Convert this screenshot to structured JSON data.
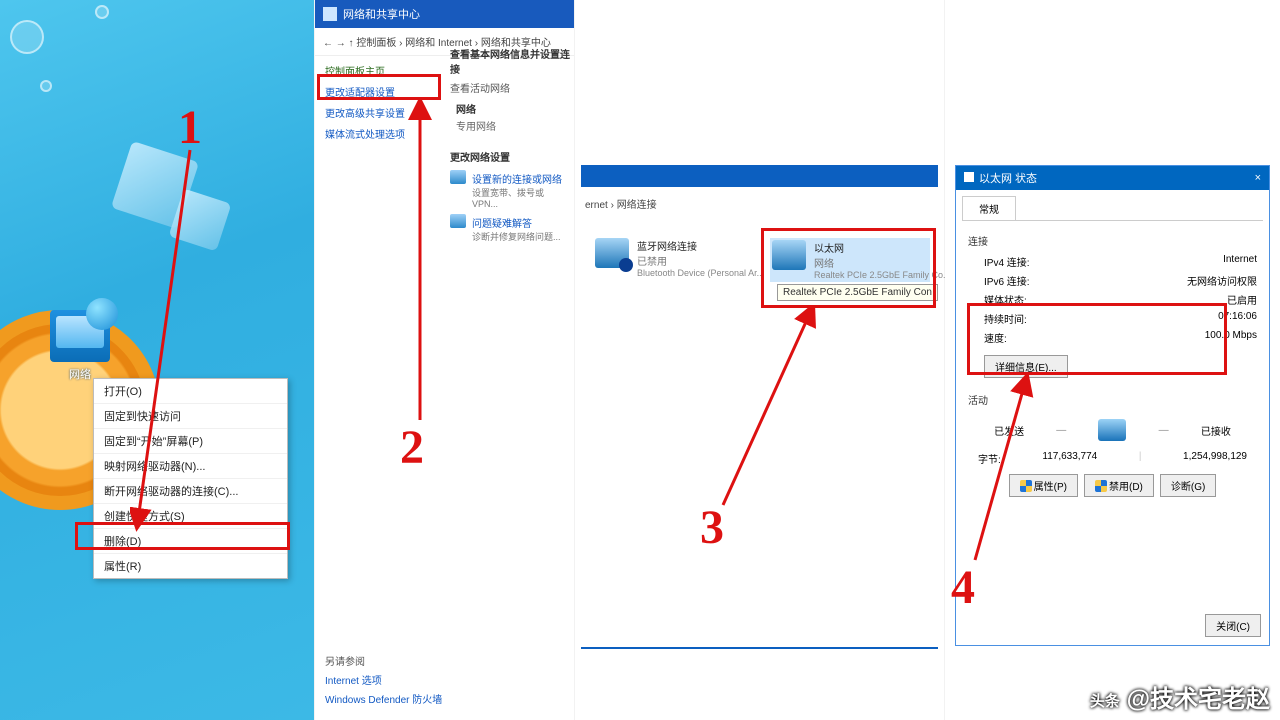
{
  "steps": {
    "one": "1",
    "two": "2",
    "three": "3",
    "four": "4"
  },
  "panel1": {
    "icon_label": "网络",
    "context_menu": [
      "打开(O)",
      "固定到快速访问",
      "固定到“开始”屏幕(P)",
      "映射网络驱动器(N)...",
      "断开网络驱动器的连接(C)...",
      "创建快捷方式(S)",
      "删除(D)",
      "属性(R)"
    ]
  },
  "panel2": {
    "title": "网络和共享中心",
    "breadcrumb_items": [
      "控制面板",
      "网络和 Internet",
      "网络和共享中心"
    ],
    "side": {
      "header": "控制面板主页",
      "links": [
        "更改适配器设置",
        "更改高级共享设置",
        "媒体流式处理选项"
      ]
    },
    "main": {
      "section1_title": "查看基本网络信息并设置连接",
      "active_head": "查看活动网络",
      "network_name": "网络",
      "network_type": "专用网络",
      "section2_title": "更改网络设置",
      "link1": "设置新的连接或网络",
      "link1_sub": "设置宽带、拨号或 VPN...",
      "link2": "问题疑难解答",
      "link2_sub": "诊断并修复网络问题..."
    },
    "footer": {
      "head": "另请参阅",
      "l1": "Internet 选项",
      "l2": "Windows Defender 防火墙"
    }
  },
  "panel3": {
    "breadcrumb_suffix": "网络连接",
    "prefix": "ernet ›",
    "item_bt": {
      "name": "蓝牙网络连接",
      "status": "已禁用",
      "device": "Bluetooth Device (Personal Ar..."
    },
    "item_eth": {
      "name": "以太网",
      "status": "网络",
      "device": "Realtek PCIe 2.5GbE Family Co..."
    },
    "tooltip": "Realtek PCIe 2.5GbE Family Con"
  },
  "panel4": {
    "title": "以太网 状态",
    "close": "×",
    "tab": "常规",
    "sec_conn": "连接",
    "rows": {
      "ipv4_l": "IPv4 连接:",
      "ipv4_v": "Internet",
      "ipv6_l": "IPv6 连接:",
      "ipv6_v": "无网络访问权限",
      "media_l": "媒体状态:",
      "media_v": "已启用",
      "dur_l": "持续时间:",
      "dur_v": "07:16:06",
      "speed_l": "速度:",
      "speed_v": "100.0 Mbps"
    },
    "btn_details": "详细信息(E)...",
    "sec_activity": "活动",
    "sent_label": "已发送",
    "recv_label": "已接收",
    "bytes_label": "字节:",
    "sent_bytes": "117,633,774",
    "recv_bytes": "1,254,998,129",
    "btn_props": "属性(P)",
    "btn_disable": "禁用(D)",
    "btn_diag": "诊断(G)",
    "btn_close": "关闭(C)"
  },
  "watermark": {
    "prefix": "头条",
    "author": "@技术宅老赵"
  }
}
